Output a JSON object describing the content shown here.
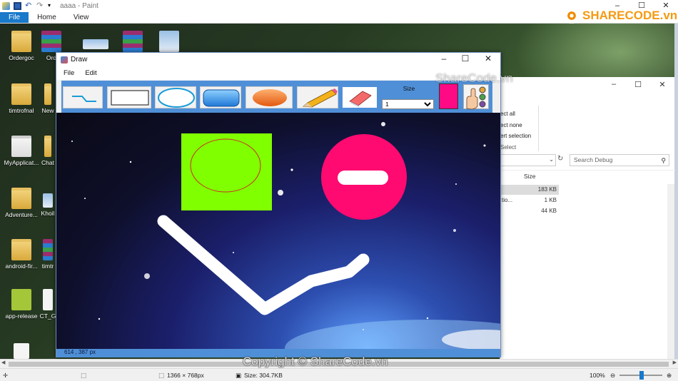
{
  "paint": {
    "title": "aaaa - Paint",
    "tabs": [
      "File",
      "Home",
      "View"
    ],
    "status": {
      "dimensions": "1366 × 768px",
      "size": "Size: 304.7KB",
      "zoom": "100%"
    }
  },
  "desktop": {
    "icons": [
      {
        "label": "Ordergoc",
        "kind": "folder"
      },
      {
        "label": "Ord",
        "kind": "rar"
      },
      {
        "label": "timtrofnal",
        "kind": "folder"
      },
      {
        "label": "New",
        "kind": "folder"
      },
      {
        "label": "MyApplicat...",
        "kind": "folder"
      },
      {
        "label": "Chat",
        "kind": "folder"
      },
      {
        "label": "Adventure...",
        "kind": "folder"
      },
      {
        "label": "Khoil",
        "kind": "image"
      },
      {
        "label": "android-fir...",
        "kind": "folder"
      },
      {
        "label": "timtr",
        "kind": "rar"
      },
      {
        "label": "app-release",
        "kind": "apk"
      },
      {
        "label": "CT_G",
        "kind": "document"
      }
    ]
  },
  "explorer": {
    "ribbon_options": [
      "ect all",
      "ect none",
      "ert selection",
      "Select"
    ],
    "search_placeholder": "Search Debug",
    "column_size": "Size",
    "rows": [
      {
        "name": "",
        "size": "183 KB"
      },
      {
        "name": "tio...",
        "size": "1 KB"
      },
      {
        "name": "",
        "size": "44 KB"
      }
    ]
  },
  "draw_app": {
    "title": "Draw",
    "menu": [
      "File",
      "Edit"
    ],
    "tools": [
      "line-tool",
      "rectangle-tool",
      "ellipse-tool",
      "rounded-rectangle-tool",
      "filled-ellipse-tool",
      "pencil-tool",
      "eraser-tool"
    ],
    "size_label": "Size",
    "size_value": "1",
    "size_options": [
      "1"
    ],
    "selected_color": "#ff0a85",
    "status_coords": "614 , 387 px"
  },
  "watermark": {
    "copyright": "Copyright © ShareCode.vn",
    "brand": "ShareCode.vn",
    "logo_text": "SHARECODE.vn"
  }
}
